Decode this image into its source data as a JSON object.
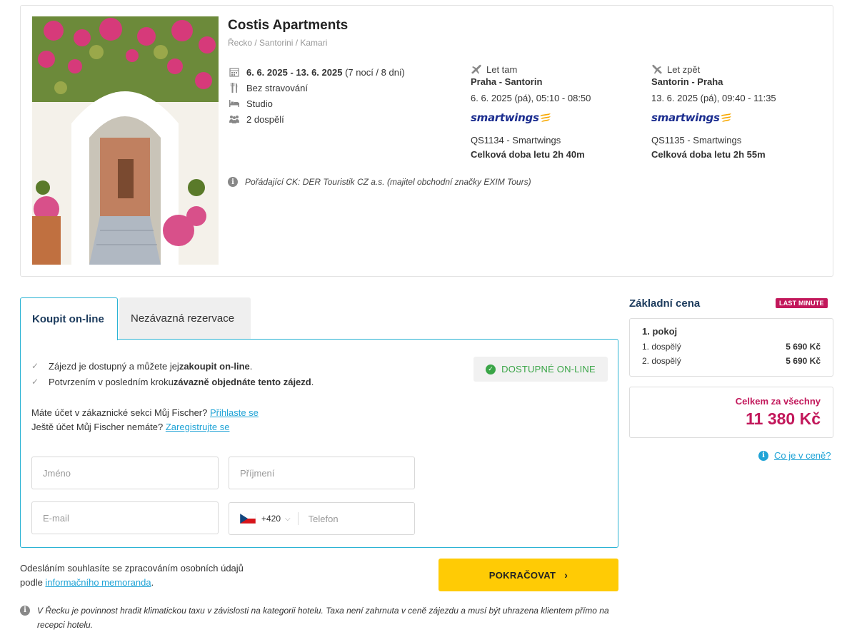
{
  "hotel": {
    "name": "Costis Apartments",
    "location": "Řecko / Santorini / Kamari",
    "dates": "6. 6. 2025 - 13. 6. 2025",
    "duration": "(7 nocí / 8 dní)",
    "board": "Bez stravování",
    "room": "Studio",
    "travellers": "2 dospělí",
    "organizer": "Pořádající CK: DER Touristik CZ a.s. (majitel obchodní značky EXIM Tours)"
  },
  "flights": {
    "outbound": {
      "label": "Let tam",
      "route": "Praha - Santorin",
      "time": "6. 6. 2025 (pá), 05:10 - 08:50",
      "airline_logo": "smartwings",
      "code": "QS1134 - Smartwings",
      "duration": "Celková doba letu 2h 40m"
    },
    "inbound": {
      "label": "Let zpět",
      "route": "Santorin - Praha",
      "time": "13. 6. 2025 (pá), 09:40 - 11:35",
      "airline_logo": "smartwings",
      "code": "QS1135 - Smartwings",
      "duration": "Celková doba letu 2h 55m"
    }
  },
  "tabs": {
    "buy": "Koupit on-line",
    "reserve": "Nezávazná rezervace"
  },
  "form": {
    "check1_pre": "Zájezd je dostupný a můžete jej ",
    "check1_bold": "zakoupit on-line",
    "check1_post": ".",
    "check2_pre": "Potvrzením v posledním kroku ",
    "check2_bold": "závazně objednáte tento zájezd",
    "check2_post": ".",
    "availability": "DOSTUPNÉ ON-LINE",
    "account_q": "Máte účet v zákaznické sekci Můj Fischer? ",
    "login_link": "Přihlaste se",
    "noaccount_q": "Ještě účet Můj Fischer nemáte? ",
    "register_link": "Zaregistrujte se",
    "first_name_placeholder": "Jméno",
    "last_name_placeholder": "Příjmení",
    "email_placeholder": "E-mail",
    "phone_prefix": "+420",
    "phone_placeholder": "Telefon"
  },
  "consent": {
    "line1": "Odesláním souhlasíte se zpracováním osobních údajů",
    "line2_pre": "podle ",
    "link": "informačního memoranda",
    "line2_post": "."
  },
  "continue_label": "POKRAČOVAT",
  "tax_note": "V Řecku je povinnost hradit klimatickou taxu v závislosti na kategorii hotelu. Taxa není zahrnuta v ceně zájezdu a musí být uhrazena klientem přímo na recepci hotelu.",
  "price": {
    "title": "Základní cena",
    "badge": "LAST MINUTE",
    "room_label": "1. pokoj",
    "rows": [
      {
        "label": "1. dospělý",
        "value": "5 690 Kč"
      },
      {
        "label": "2. dospělý",
        "value": "5 690 Kč"
      }
    ],
    "total_label": "Celkem za všechny",
    "total_value": "11 380 Kč",
    "whats_included": "Co je v ceně?"
  },
  "colors": {
    "accent_blue": "#2bb3d4",
    "brand_magenta": "#c2185b",
    "cta_yellow": "#ffcb05",
    "available_green": "#3aa547"
  }
}
